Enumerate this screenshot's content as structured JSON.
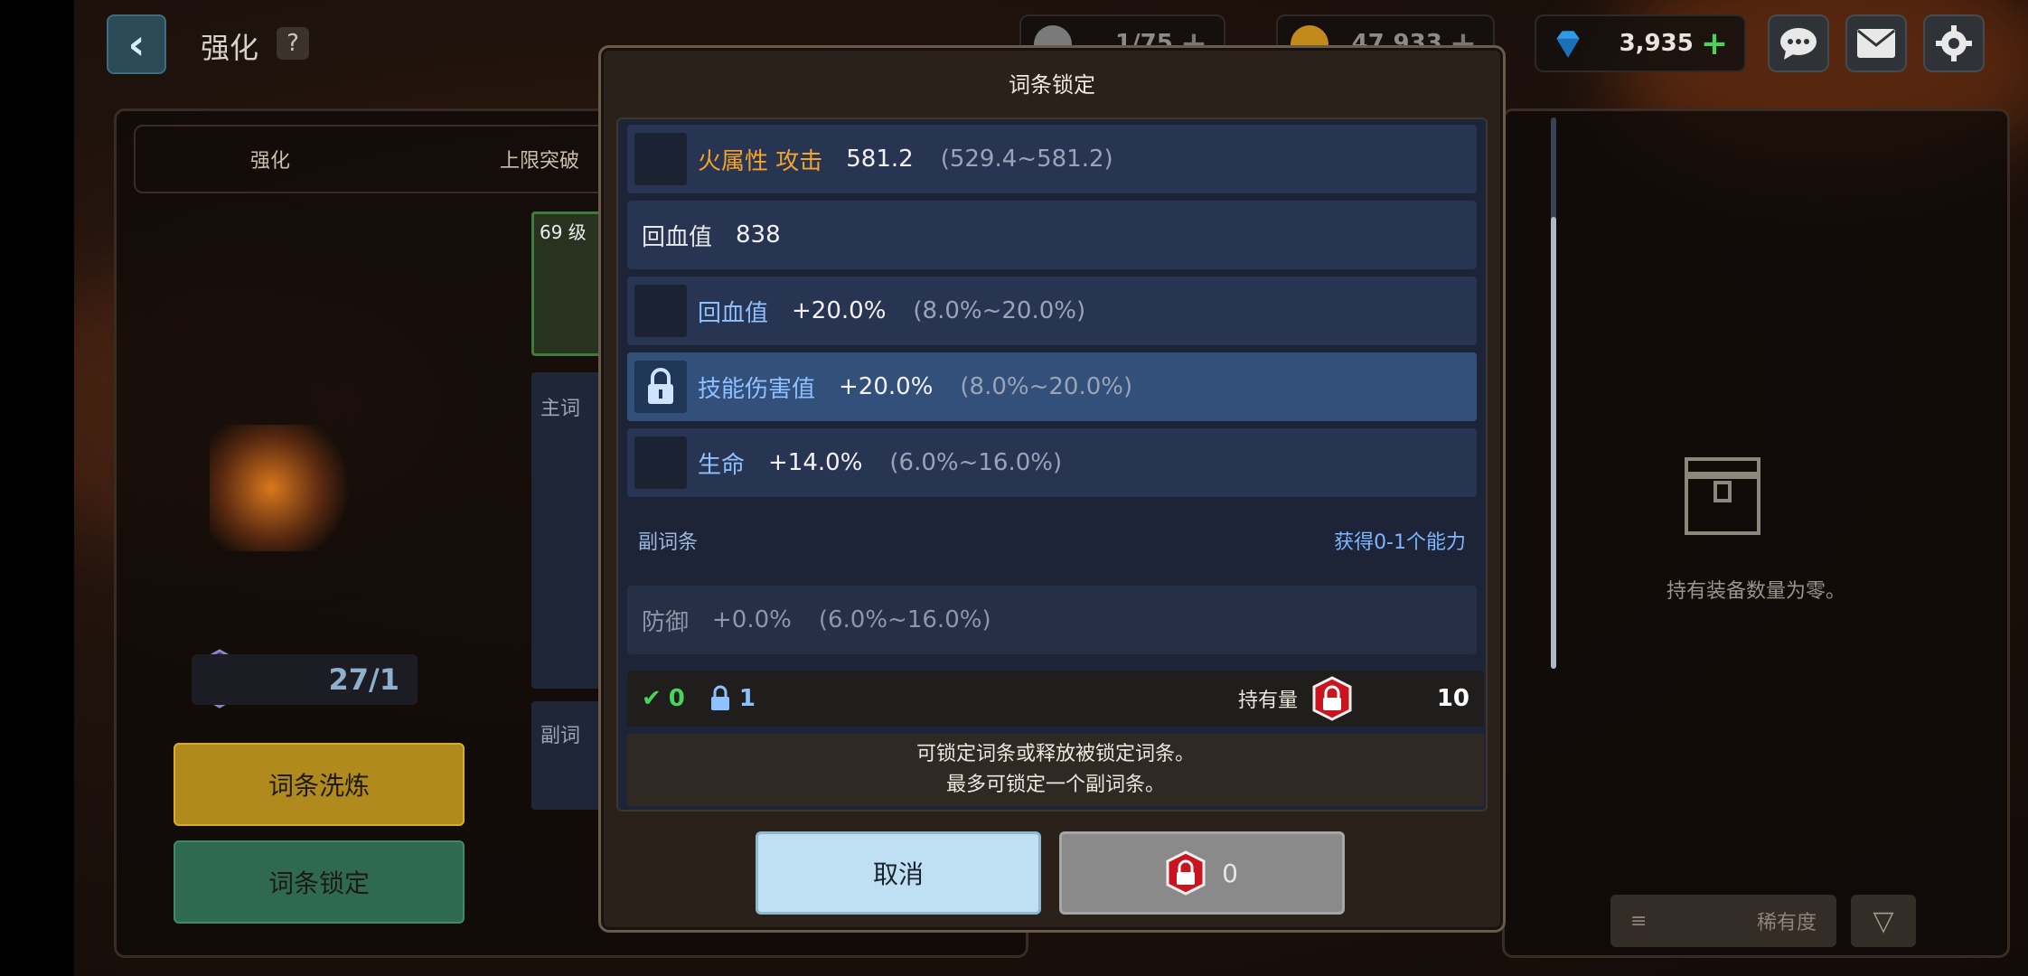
{
  "header": {
    "title": "强化",
    "help": "?"
  },
  "resources": [
    {
      "name": "stamina",
      "value": "1/75"
    },
    {
      "name": "gold",
      "value": "47,933"
    },
    {
      "name": "gems",
      "value": "3,935"
    }
  ],
  "tabs": [
    "强化",
    "上限突破"
  ],
  "side_labels": {
    "main": "主词",
    "sub": "副词",
    "level": "69 级"
  },
  "counter": "27/1",
  "left_buttons": {
    "reroll": "词条洗炼",
    "lock": "词条锁定"
  },
  "inventory": {
    "empty_text": "持有装备数量为零。",
    "sort_label": "稀有度"
  },
  "modal": {
    "title": "词条锁定",
    "rows": [
      {
        "name": "火属性 攻击",
        "value": "581.2",
        "range": "(529.4~581.2)",
        "type": "fire",
        "lockable": true,
        "locked": false
      },
      {
        "name": "回血值",
        "value": "838",
        "range": "",
        "type": "plain",
        "lockable": false,
        "locked": false
      },
      {
        "name": "回血值",
        "value": "+20.0%",
        "range": "(8.0%~20.0%)",
        "type": "normal",
        "lockable": true,
        "locked": false
      },
      {
        "name": "技能伤害值",
        "value": "+20.0%",
        "range": "(8.0%~20.0%)",
        "type": "normal",
        "lockable": true,
        "locked": true
      },
      {
        "name": "生命",
        "value": "+14.0%",
        "range": "(6.0%~16.0%)",
        "type": "normal",
        "lockable": true,
        "locked": false
      }
    ],
    "sub_header": {
      "left": "副词条",
      "right": "获得0-1个能力"
    },
    "sub_row": {
      "name": "防御",
      "value": "+0.0%",
      "range": "(6.0%~16.0%)"
    },
    "status": {
      "checked": "0",
      "locked": "1",
      "holding_label": "持有量",
      "holding_value": "10"
    },
    "note_line1": "可锁定词条或释放被锁定词条。",
    "note_line2": "最多可锁定一个副词条。",
    "cancel": "取消",
    "confirm_cost": "0"
  },
  "colors": {
    "accent_fire": "#f2a42a",
    "stat_blue": "#8ec1ff",
    "green": "#49d35a",
    "lock_red": "#c8151f"
  }
}
